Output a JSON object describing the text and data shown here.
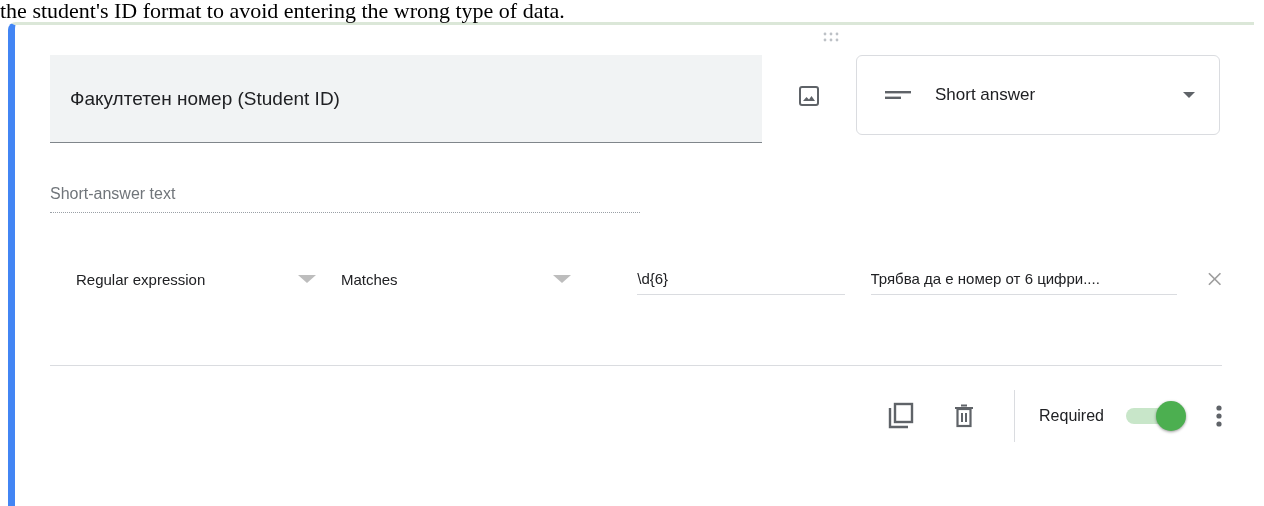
{
  "intro_text": "the student's ID format to avoid entering the wrong type of data.",
  "question": {
    "title": "Факултетен номер (Student ID)",
    "type": "Short answer",
    "answer_placeholder": "Short-answer text"
  },
  "validation": {
    "type": "Regular expression",
    "condition": "Matches",
    "pattern": "\\d{6}",
    "error_text": "Трябва да е номер от 6 цифри...."
  },
  "footer": {
    "required_label": "Required",
    "required": true
  }
}
